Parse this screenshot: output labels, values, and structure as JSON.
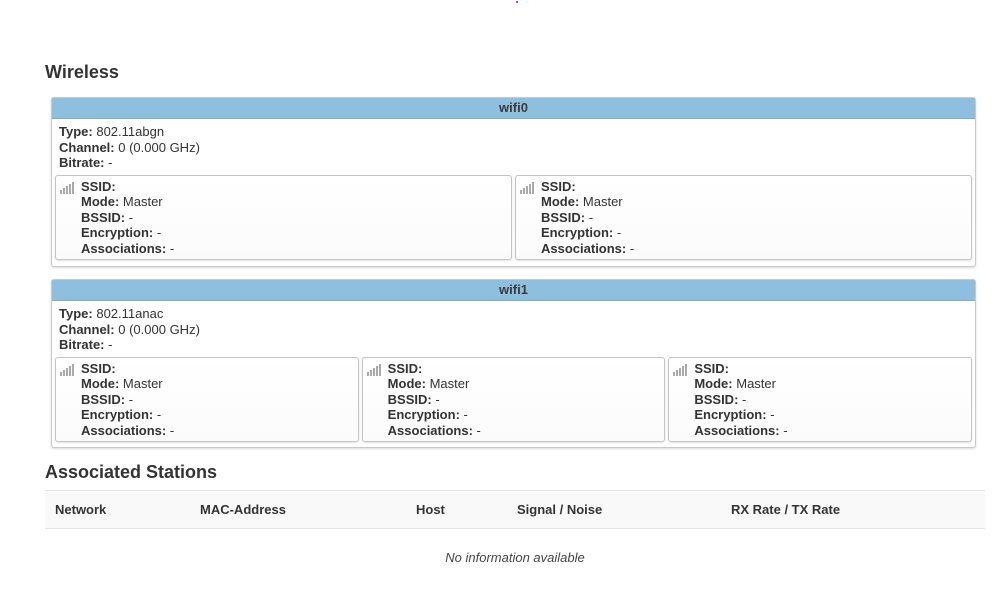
{
  "wireless": {
    "title": "Wireless",
    "radios": [
      {
        "name": "wifi0",
        "type_label": "Type:",
        "type": "802.11abgn",
        "channel_label": "Channel:",
        "channel": "0 (0.000 GHz)",
        "bitrate_label": "Bitrate:",
        "bitrate": "-",
        "interfaces": [
          {
            "ssid_label": "SSID:",
            "ssid": "",
            "mode_label": "Mode:",
            "mode": "Master",
            "bssid_label": "BSSID:",
            "bssid": "-",
            "encryption_label": "Encryption:",
            "encryption": "-",
            "associations_label": "Associations:",
            "associations": "-"
          },
          {
            "ssid_label": "SSID:",
            "ssid": "",
            "mode_label": "Mode:",
            "mode": "Master",
            "bssid_label": "BSSID:",
            "bssid": "-",
            "encryption_label": "Encryption:",
            "encryption": "-",
            "associations_label": "Associations:",
            "associations": "-"
          }
        ]
      },
      {
        "name": "wifi1",
        "type_label": "Type:",
        "type": "802.11anac",
        "channel_label": "Channel:",
        "channel": "0 (0.000 GHz)",
        "bitrate_label": "Bitrate:",
        "bitrate": "-",
        "interfaces": [
          {
            "ssid_label": "SSID:",
            "ssid": "",
            "mode_label": "Mode:",
            "mode": "Master",
            "bssid_label": "BSSID:",
            "bssid": "-",
            "encryption_label": "Encryption:",
            "encryption": "-",
            "associations_label": "Associations:",
            "associations": "-"
          },
          {
            "ssid_label": "SSID:",
            "ssid": "",
            "mode_label": "Mode:",
            "mode": "Master",
            "bssid_label": "BSSID:",
            "bssid": "-",
            "encryption_label": "Encryption:",
            "encryption": "-",
            "associations_label": "Associations:",
            "associations": "-"
          },
          {
            "ssid_label": "SSID:",
            "ssid": "",
            "mode_label": "Mode:",
            "mode": "Master",
            "bssid_label": "BSSID:",
            "bssid": "-",
            "encryption_label": "Encryption:",
            "encryption": "-",
            "associations_label": "Associations:",
            "associations": "-"
          }
        ]
      }
    ]
  },
  "stations": {
    "title": "Associated Stations",
    "columns": [
      "Network",
      "MAC-Address",
      "Host",
      "Signal / Noise",
      "RX Rate / TX Rate"
    ],
    "empty_text": "No information available"
  },
  "icons": {
    "interface": "wireless-signal-icon"
  },
  "colors": {
    "header_bg": "#8fbfdf",
    "accent_dot": "#c0143c"
  }
}
